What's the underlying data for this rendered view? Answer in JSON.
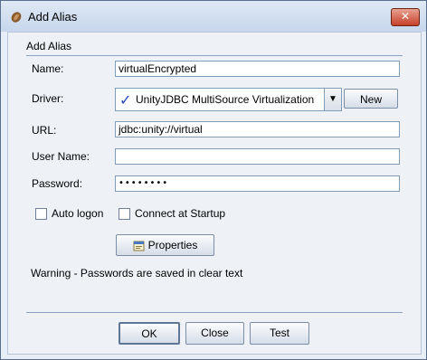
{
  "window": {
    "title": "Add Alias",
    "close_glyph": "✕"
  },
  "group": {
    "title": "Add Alias"
  },
  "form": {
    "name_label": "Name:",
    "name_value": "virtualEncrypted",
    "driver_label": "Driver:",
    "driver_value": "UnityJDBC MultiSource Virtualization",
    "driver_icon": "check-icon",
    "new_button": "New",
    "url_label": "URL:",
    "url_value": "jdbc:unity://virtual",
    "username_label": "User Name:",
    "username_value": "",
    "password_label": "Password:",
    "password_value": "••••••••"
  },
  "options": {
    "auto_logon": {
      "label": "Auto logon",
      "checked": false
    },
    "connect_startup": {
      "label": "Connect at Startup",
      "checked": false
    }
  },
  "properties_button": "Properties",
  "warning": "Warning - Passwords are saved in clear text",
  "buttons": {
    "ok": "OK",
    "close": "Close",
    "test": "Test"
  },
  "colors": {
    "accent": "#1f46b8",
    "close_button": "#c7402a",
    "border": "#7f9db9"
  }
}
